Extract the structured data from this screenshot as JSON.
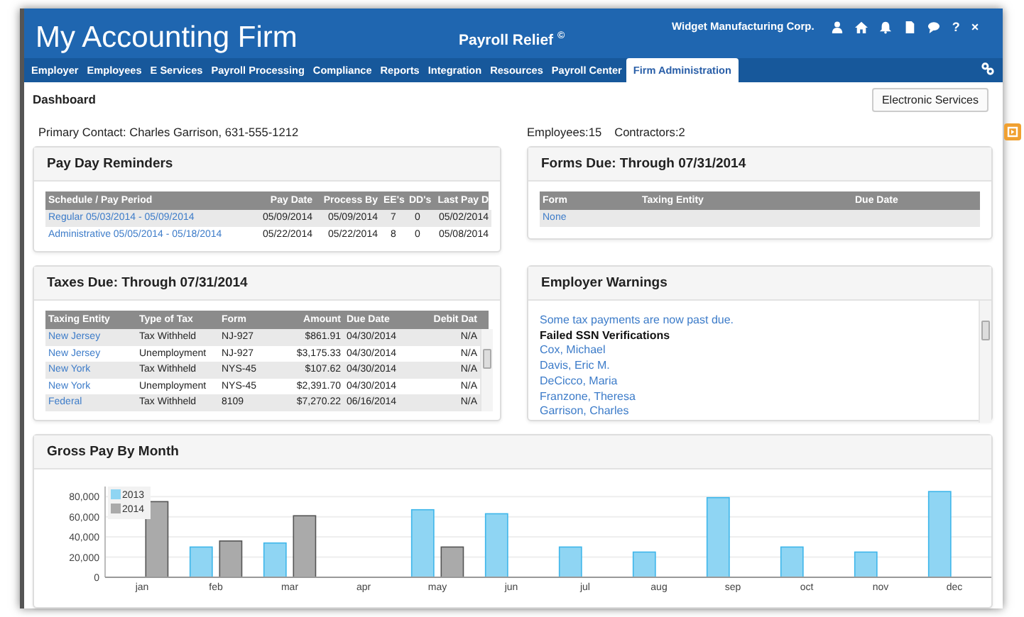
{
  "header": {
    "title": "My Accounting Firm",
    "product": "Payroll Relief $^{©}$",
    "company": "Widget Manufacturing Corp.",
    "help": "?",
    "close": "×"
  },
  "nav": {
    "tabs": [
      {
        "label": "Employer",
        "selected": false
      },
      {
        "label": "Employees",
        "selected": false
      },
      {
        "label": "E Services",
        "selected": false
      },
      {
        "label": "Payroll Processing",
        "selected": false
      },
      {
        "label": "Compliance",
        "selected": false
      },
      {
        "label": "Reports",
        "selected": false
      },
      {
        "label": "Integration",
        "selected": false
      },
      {
        "label": "Resources",
        "selected": false
      },
      {
        "label": "Payroll Center",
        "selected": false
      },
      {
        "label": "Firm Administration",
        "selected": true
      }
    ]
  },
  "page": {
    "title": "Dashboard",
    "action_button": "Electronic Services",
    "primary_contact": "Primary Contact: Charles Garrison, 631-555-1212",
    "employees": "Employees:15",
    "contractors": "Contractors:2"
  },
  "pay_day_reminders": {
    "title": "Pay Day Reminders",
    "columns": [
      "Schedule / Pay Period",
      "Pay Date",
      "Process By",
      "EE's",
      "DD's",
      "Last Pay D"
    ],
    "rows": [
      [
        "Regular 05/03/2014 - 05/09/2014",
        "05/09/2014",
        "05/09/2014",
        "7",
        "0",
        "05/02/2014"
      ],
      [
        "Administrative 05/05/2014 - 05/18/2014",
        "05/22/2014",
        "05/22/2014",
        "8",
        "0",
        "05/08/2014"
      ]
    ]
  },
  "forms_due": {
    "title": "Forms Due: Through 07/31/2014",
    "columns": [
      "Form",
      "Taxing Entity",
      "Due Date"
    ],
    "rows": [
      [
        "None",
        "",
        ""
      ]
    ]
  },
  "taxes_due": {
    "title": "Taxes Due: Through 07/31/2014",
    "columns": [
      "Taxing Entity",
      "Type of Tax",
      "Form",
      "Amount",
      "Due Date",
      "Debit Dat"
    ],
    "rows": [
      [
        "New Jersey",
        "Tax Withheld",
        "NJ-927",
        "$861.91",
        "04/30/2014",
        "N/A"
      ],
      [
        "New Jersey",
        "Unemployment",
        "NJ-927",
        "$3,175.33",
        "04/30/2014",
        "N/A"
      ],
      [
        "New York",
        "Tax Withheld",
        "NYS-45",
        "$107.62",
        "04/30/2014",
        "N/A"
      ],
      [
        "New York",
        "Unemployment",
        "NYS-45",
        "$2,391.70",
        "04/30/2014",
        "N/A"
      ],
      [
        "Federal",
        "Tax Withheld",
        "8109",
        "$7,270.22",
        "06/16/2014",
        "N/A"
      ]
    ]
  },
  "employer_warnings": {
    "title": "Employer Warnings",
    "items": [
      {
        "kind": "link",
        "text": "Some tax payments are now past due."
      },
      {
        "kind": "heading",
        "text": "Failed SSN Verifications"
      },
      {
        "kind": "link",
        "text": "Cox, Michael"
      },
      {
        "kind": "link",
        "text": "Davis, Eric M."
      },
      {
        "kind": "link",
        "text": "DeCicco, Maria"
      },
      {
        "kind": "link",
        "text": "Franzone, Theresa"
      },
      {
        "kind": "link",
        "text": "Garrison, Charles"
      }
    ]
  },
  "gross_pay": {
    "title": "Gross Pay By Month",
    "chart_data": {
      "type": "bar",
      "categories": [
        "jan",
        "feb",
        "mar",
        "apr",
        "may",
        "jun",
        "jul",
        "aug",
        "sep",
        "oct",
        "nov",
        "dec"
      ],
      "grid": true,
      "legend": true,
      "series": [
        {
          "name": "2013",
          "color": "#8fd5f3",
          "values": [
            null,
            30000,
            34000,
            null,
            67000,
            63000,
            30000,
            25000,
            79000,
            30000,
            25000,
            85000
          ]
        },
        {
          "name": "2014",
          "color": "#aaaaaa",
          "values": [
            75000,
            36000,
            61000,
            null,
            30000,
            null,
            null,
            null,
            null,
            null,
            null,
            null
          ]
        }
      ],
      "ylim": [
        0,
        90000
      ],
      "yticks": [
        {
          "value": 0,
          "label": "0"
        },
        {
          "value": 20000,
          "label": "20,000"
        },
        {
          "value": 40000,
          "label": "40,000"
        },
        {
          "value": 60000,
          "label": "60,000"
        },
        {
          "value": 80000,
          "label": "80,000"
        }
      ]
    }
  }
}
